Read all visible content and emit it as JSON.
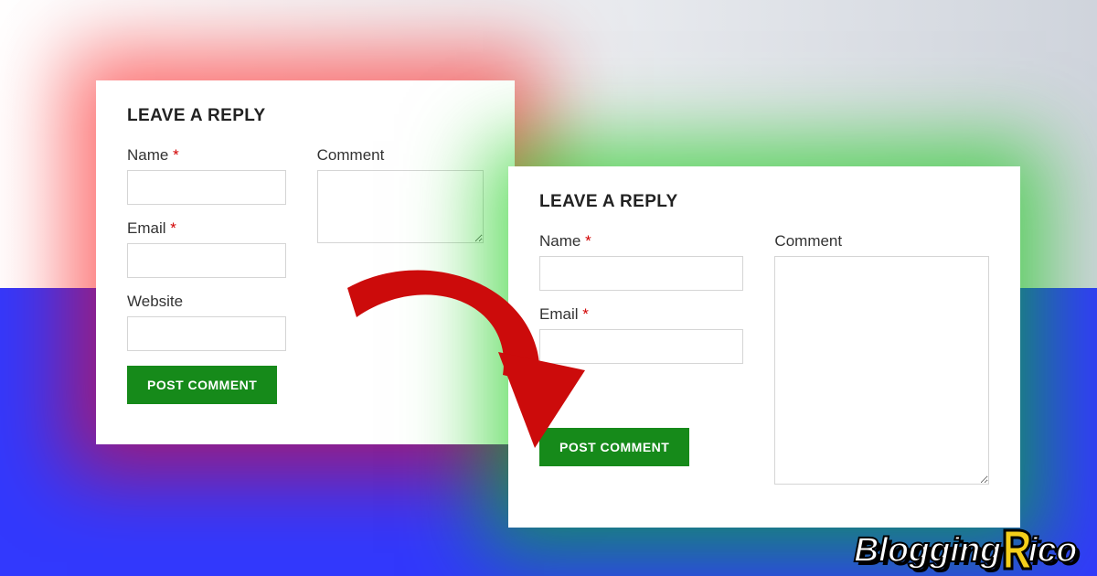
{
  "formLeft": {
    "heading": "LEAVE A REPLY",
    "name_label": "Name",
    "email_label": "Email",
    "website_label": "Website",
    "comment_label": "Comment",
    "required_mark": "*",
    "button_label": "POST COMMENT"
  },
  "formRight": {
    "heading": "LEAVE A REPLY",
    "name_label": "Name",
    "email_label": "Email",
    "comment_label": "Comment",
    "required_mark": "*",
    "button_label": "POST COMMENT"
  },
  "brand": {
    "part1": "Blogging",
    "part2": "ico"
  },
  "colors": {
    "glow_before": "#ff0000",
    "glow_after": "#00c800",
    "button": "#168a1a",
    "bg_lower": "#3239fd",
    "arrow": "#cc0b0b"
  }
}
